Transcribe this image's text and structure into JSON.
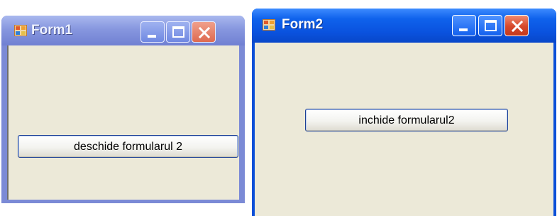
{
  "windows": [
    {
      "title": "Form1",
      "button_label": "deschide formularul 2",
      "state": "inactive"
    },
    {
      "title": "Form2",
      "button_label": "inchide formularul2",
      "state": "active"
    }
  ],
  "icons": {
    "app": "form-app-icon",
    "minimize": "minimize-icon",
    "maximize": "maximize-icon",
    "close": "close-icon"
  },
  "colors": {
    "client_background": "#ece9d8",
    "active_titlebar": "#0a52de",
    "inactive_titlebar": "#8797df",
    "close_button": "#d6482a"
  }
}
